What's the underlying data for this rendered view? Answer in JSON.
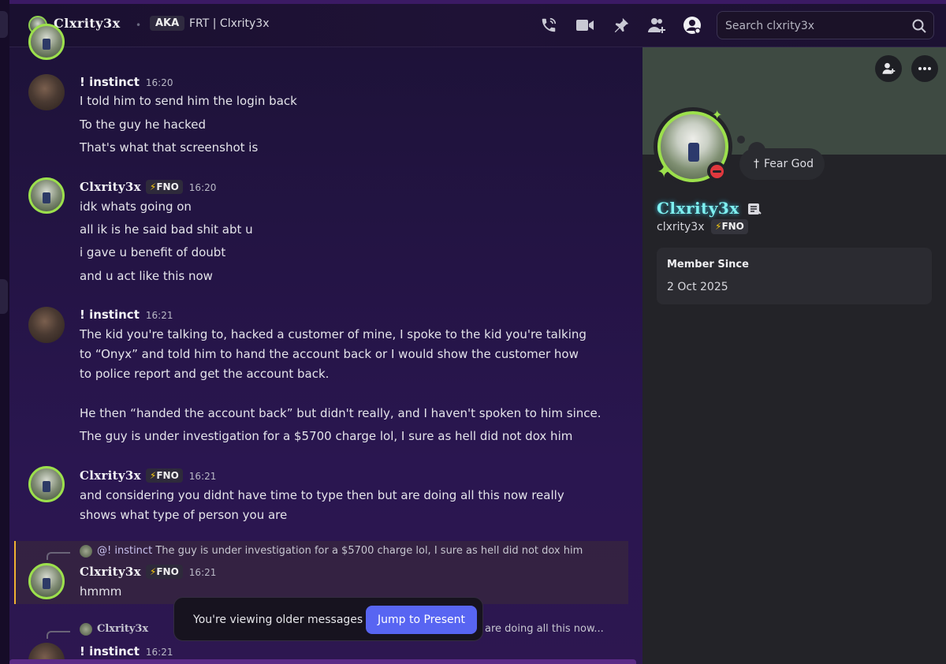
{
  "header": {
    "channel_name": "Clxrity3x",
    "separator": "•",
    "tag": "AKA",
    "aka_text": "FRT | Clxrity3x",
    "icons": [
      "phone-call-icon",
      "video-icon",
      "pin-icon",
      "add-friend-icon",
      "user-profile-icon"
    ],
    "search_placeholder": "Search clxrity3x"
  },
  "messages": [
    {
      "author": "! instinct",
      "time": "16:20",
      "lines": [
        "I told him to send him the login back",
        "To the guy he hacked",
        "That's what that screenshot is"
      ]
    },
    {
      "author": "Clxrity3x",
      "badge": "FNO",
      "time": "16:20",
      "lines": [
        "idk whats going on",
        "all ik is he said bad shit abt u",
        "i gave u benefit of doubt",
        "and u act like this now"
      ]
    },
    {
      "author": "! instinct",
      "time": "16:21",
      "lines": [
        "The kid you're talking to, hacked a customer of mine, I spoke to the kid you're talking",
        "to “Onyx” and told him to hand the account back or I would show the customer how",
        "to police report and get the account back.",
        "He then “handed the account back” but didn't really, and I haven't spoken to him since.",
        "The guy is under investigation for a $5700 charge lol, I sure as hell did not dox him"
      ]
    },
    {
      "author": "Clxrity3x",
      "badge": "FNO",
      "time": "16:21",
      "lines": [
        "and considering you didnt have time to type then but are doing all this now really",
        "shows what type of person you are"
      ]
    },
    {
      "reply_mention": "@! instinct",
      "reply_text": "The guy is under investigation for a $5700 charge lol, I sure as hell did not dox him",
      "author": "Clxrity3x",
      "badge": "FNO",
      "time": "16:21",
      "lines": [
        "hmmm"
      ]
    },
    {
      "reply_mention": "Clxrity3x",
      "reply_text": "are doing all this now...",
      "author": "! instinct",
      "time": "16:21"
    }
  ],
  "toast": {
    "label": "You're viewing older messages",
    "button": "Jump to Present"
  },
  "profile": {
    "status": "Fear God",
    "status_icon": "†",
    "display_name": "Clxrity3x",
    "username": "clxrity3x",
    "badge": "FNO",
    "member_since_title": "Member Since",
    "member_since_value": "2 Oct 2025"
  },
  "colors": {
    "accent": "#5865f2",
    "avatar_ring": "#9ce04c",
    "dnd": "#e0383e",
    "highlight_border": "#f0b232",
    "name_glow": "#7ff0f0"
  }
}
